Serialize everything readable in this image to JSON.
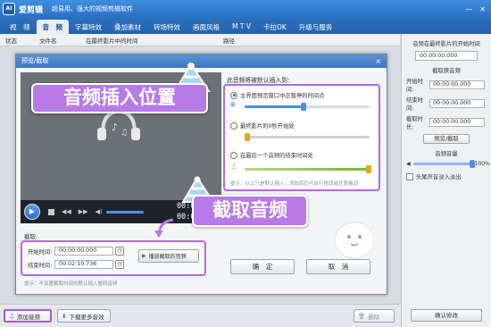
{
  "app": {
    "logo_text": "AI",
    "name": "爱剪辑",
    "slogan": "超易用、强大的视频剪辑软件",
    "window_buttons": [
      "—",
      "✕"
    ]
  },
  "tabs": [
    "视　频",
    "音　频",
    "字幕特效",
    "叠加素材",
    "转场特效",
    "画面风格",
    "M T V",
    "卡拉OK",
    "升级与服务"
  ],
  "active_tab": "音　频",
  "columns": [
    "状态",
    "文件名",
    "在最终影片中的时间",
    "路径"
  ],
  "right_panel": {
    "title": "音频在最终影片的开始时间",
    "start_value": "00:00:00.000",
    "cut_section_title": "截取原音频",
    "rows": [
      {
        "label": "开始时间:",
        "value": "00:00:00.000"
      },
      {
        "label": "结束时间:",
        "value": "00:00:00.000"
      },
      {
        "label": "截取时长:",
        "value": "00:00:00.000"
      }
    ],
    "preview_button": "预览/截取",
    "volume_title": "音频音量",
    "volume_value": "100%",
    "fade_checkbox": "头尾声音淡入淡出",
    "confirm_button": "确认修改"
  },
  "bottom_bar": {
    "add_audio": "添加音频",
    "more_audio": "下载更多音效",
    "delete": "删除"
  },
  "dialog": {
    "title": "预览/截取",
    "close_label": "×",
    "timecode_current": "00:00:00.",
    "timecode_total": "00:02:10.",
    "insert_title": "此音频将被默认插入到:",
    "options": [
      {
        "label": "主界面预览窗口中正暂停的时间点",
        "selected": true
      },
      {
        "label": "最终影片的0秒开始处",
        "selected": false
      },
      {
        "label": "在最后一个音频的结束时间处",
        "selected": false
      }
    ],
    "insert_tip": "提示：以上只是默认插入，添加后仍可自行修改或任意拖动",
    "cut_label": "截取:",
    "cut_start_label": "开始时间:",
    "cut_start_value": "00:00:00.000",
    "cut_end_label": "结束时间:",
    "cut_end_value": "00:02:10.736",
    "play_cut_button": "播放截取的音频",
    "cut_tip": "提示：不设置截取时间则默认插入整段音频",
    "ok_button": "确　定",
    "cancel_button": "取　消"
  },
  "callouts": {
    "insert_position": "音频插入位置",
    "cut_audio": "截取音频"
  },
  "colors": {
    "accent_purple": "#b77ae6",
    "title_blue": "#2a70c4"
  }
}
